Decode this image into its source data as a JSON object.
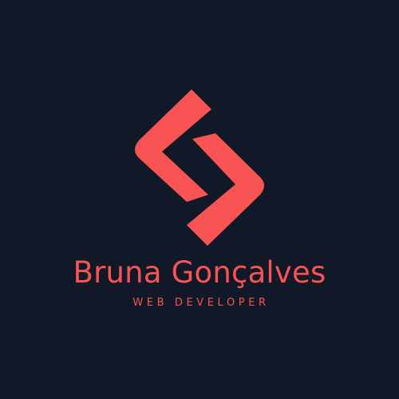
{
  "brand": {
    "name": "Bruna Gonçalves",
    "tagline": "WEB DEVELOPER"
  },
  "logo": {
    "icon": "chevron-code-icon"
  },
  "colors": {
    "background": "#111827",
    "accent": "#F85454"
  }
}
